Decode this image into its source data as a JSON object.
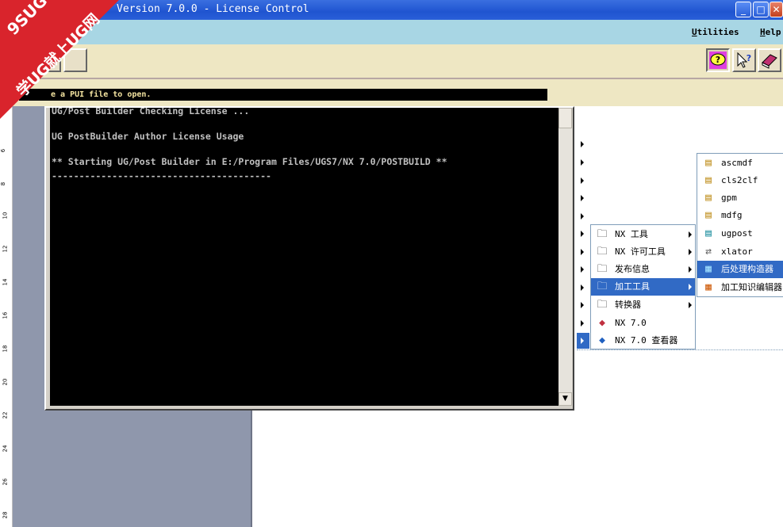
{
  "window": {
    "title": "Version 7.0.0 - License Control",
    "controls": [
      "minimize-icon",
      "maximize-icon",
      "close-icon"
    ]
  },
  "menubar": {
    "items": [
      {
        "label": "Utilities"
      },
      {
        "label": "Help"
      }
    ]
  },
  "toolbar": {
    "left_buttons": [
      "open-file-icon",
      "save-file-icon"
    ],
    "right_buttons": [
      "tooltip-help-icon",
      "context-help-icon",
      "manual-book-icon"
    ]
  },
  "status": {
    "message": "e a PUI file to open."
  },
  "console": {
    "lines": [
      "UG/Post Builder Checking License ...",
      "UG PostBuilder Author License Usage",
      "** Starting UG/Post Builder in E:/Program Files/UGS7/NX 7.0/POSTBUILD **",
      "----------------------------------------"
    ]
  },
  "ruler": {
    "ticks": [
      "4",
      "6",
      "8",
      "10",
      "12",
      "14",
      "16",
      "18",
      "20",
      "22",
      "24",
      "26",
      "28"
    ]
  },
  "start_menu": {
    "submenu": [
      {
        "label": "NX 工具",
        "icon": "folder-icon",
        "has_submenu": true
      },
      {
        "label": "NX 许可工具",
        "icon": "folder-icon",
        "has_submenu": true
      },
      {
        "label": "发布信息",
        "icon": "folder-icon",
        "has_submenu": true
      },
      {
        "label": "加工工具",
        "icon": "folder-icon",
        "has_submenu": true,
        "active": true
      },
      {
        "label": "转换器",
        "icon": "folder-icon",
        "has_submenu": true
      },
      {
        "label": "NX 7.0",
        "icon": "nx-app-icon",
        "has_submenu": false
      },
      {
        "label": "NX 7.0 查看器",
        "icon": "nx-viewer-icon",
        "has_submenu": false
      }
    ],
    "tools": [
      {
        "label": "ascmdf",
        "icon": "script-icon"
      },
      {
        "label": "cls2clf",
        "icon": "script-icon"
      },
      {
        "label": "gpm",
        "icon": "script-icon"
      },
      {
        "label": "mdfg",
        "icon": "script-icon"
      },
      {
        "label": "ugpost",
        "icon": "post-icon"
      },
      {
        "label": "xlator",
        "icon": "translator-icon"
      },
      {
        "label": "后处理构造器",
        "icon": "post-builder-icon",
        "active": true
      },
      {
        "label": "加工知识编辑器",
        "icon": "knowledge-editor-icon"
      }
    ]
  },
  "watermark": {
    "line1": "9SUG",
    "line2": "学UG就上UG网"
  },
  "colors": {
    "titlebar": "#1f54d0",
    "menubar": "#a8d6e4",
    "toolbar": "#eee7c3",
    "highlight": "#316ac5",
    "console_bg": "#000000",
    "watermark": "#d9242c"
  }
}
